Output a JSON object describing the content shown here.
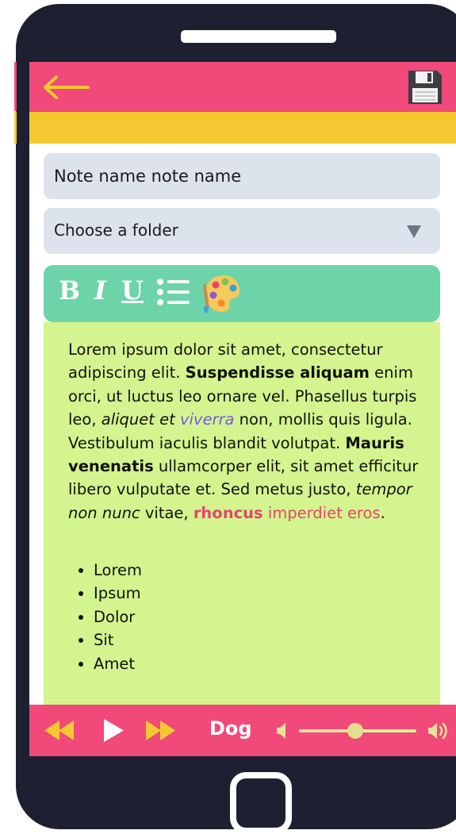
{
  "colors": {
    "phone_body": "#1d2030",
    "top_bar": "#f0497a",
    "accent_bar": "#f4c930",
    "field_bg": "#dce3ec",
    "toolbar_bg": "#6dd3a8",
    "editor_bg": "#d3f48e",
    "player_bg": "#f0497a",
    "link_violet": "#7a5be0",
    "highlight_pink": "#e8446e"
  },
  "topbar": {
    "back_icon": "arrow-left-icon",
    "save_icon": "floppy-disk-icon"
  },
  "form": {
    "note_name_value": "Note name note name",
    "folder_placeholder": "Choose a folder",
    "folder_arrow_icon": "triangle-down-icon"
  },
  "toolbar": {
    "bold_label": "B",
    "italic_label": "I",
    "underline_label": "U",
    "list_icon": "bullet-list-icon",
    "color_icon": "palette-icon"
  },
  "editor": {
    "p1": "Lorem ipsum dolor sit amet, consectetur adipiscing elit. ",
    "b1": "Suspendisse aliquam",
    "p2": " enim orci, ut luctus leo ornare vel. Phasellus turpis leo, ",
    "i1": "aliquet et ",
    "i2": "viverra",
    "p3": " non, mollis quis ligula. Vestibulum iaculis blandit volutpat. ",
    "b2": "Mauris venenatis",
    "p4": " ullamcorper elit, sit amet efficitur libero vulputate et. Sed metus justo, ",
    "i3": "tempor non nunc",
    "p5": " vitae, ",
    "b3": "rhoncus",
    "c1": " imperdiet eros",
    "p6": ".",
    "list": [
      "Lorem",
      "Ipsum",
      "Dolor",
      "Sit",
      "Amet"
    ]
  },
  "player": {
    "rewind_icon": "rewind-icon",
    "play_icon": "play-icon",
    "forward_icon": "fast-forward-icon",
    "track_name": "Dog",
    "volume_low_icon": "volume-low-icon",
    "volume_high_icon": "volume-high-icon",
    "volume_percent": 48
  }
}
